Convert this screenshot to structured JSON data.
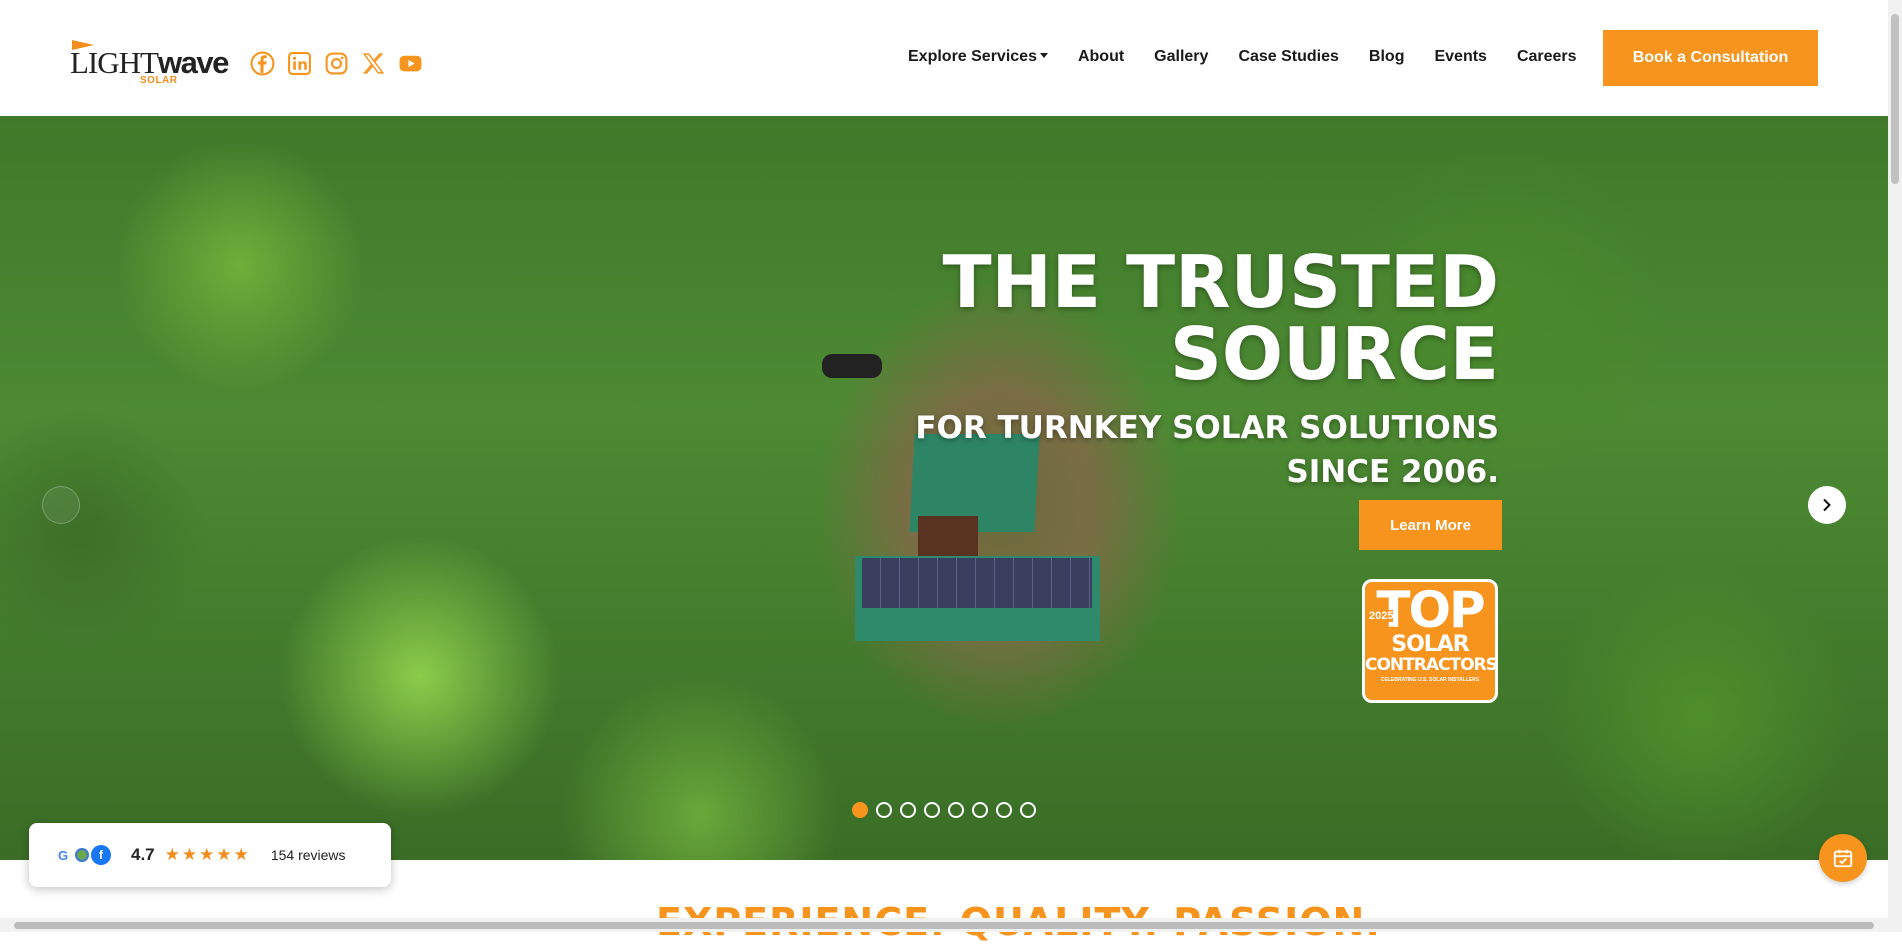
{
  "brand": {
    "logo_main": "LIGHT",
    "logo_bold": "wave",
    "logo_sub": "SOLAR",
    "accent": "#f7941d"
  },
  "social": [
    {
      "icon": "facebook-icon"
    },
    {
      "icon": "linkedin-icon"
    },
    {
      "icon": "instagram-icon"
    },
    {
      "icon": "x-twitter-icon"
    },
    {
      "icon": "youtube-icon"
    }
  ],
  "nav": {
    "explore": "Explore Services",
    "about": "About",
    "gallery": "Gallery",
    "case_studies": "Case Studies",
    "blog": "Blog",
    "events": "Events",
    "careers": "Careers"
  },
  "header": {
    "cta_label": "Book a Consultation"
  },
  "hero": {
    "title_line1": "THE TRUSTED",
    "title_line2": "SOURCE",
    "subtitle_line1": "FOR TURNKEY SOLAR SOLUTIONS",
    "subtitle_line2": "SINCE 2006.",
    "button_label": "Learn More",
    "badge_year": "2025",
    "badge_top": "TOP",
    "badge_line1": "SOLAR",
    "badge_line2": "CONTRACTORS",
    "badge_sub": "CELEBRATING U.S. SOLAR INSTALLERS",
    "slide_count": 8,
    "active_slide": 1
  },
  "reviews": {
    "score": "4.7",
    "stars": "★★★★★",
    "rating": 4.7,
    "count_label": "154 reviews"
  },
  "section": {
    "title": "EXPERIENCE. QUALITY. PASSION."
  }
}
